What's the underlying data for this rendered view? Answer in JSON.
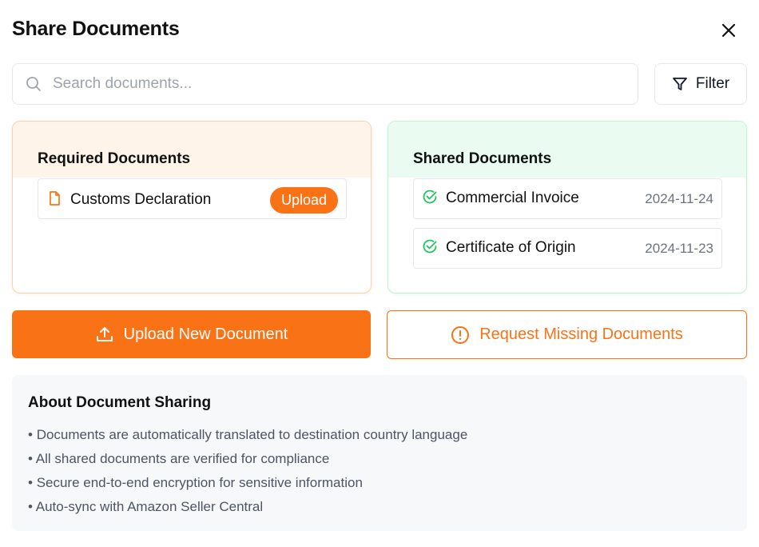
{
  "dialog": {
    "title": "Share Documents"
  },
  "search": {
    "placeholder": "Search documents...",
    "value": ""
  },
  "filter": {
    "label": "Filter"
  },
  "required": {
    "title": "Required Documents",
    "items": [
      {
        "name": "Customs Declaration",
        "action_label": "Upload"
      }
    ]
  },
  "shared": {
    "title": "Shared Documents",
    "items": [
      {
        "name": "Commercial Invoice",
        "date": "2024-11-24"
      },
      {
        "name": "Certificate of Origin",
        "date": "2024-11-23"
      }
    ]
  },
  "actions": {
    "upload_label": "Upload New Document",
    "request_label": "Request Missing Documents"
  },
  "about": {
    "title": "About Document Sharing",
    "points": [
      "Documents are automatically translated to destination country language",
      "All shared documents are verified for compliance",
      "Secure end-to-end encryption for sensitive information",
      "Auto-sync with Amazon Seller Central"
    ]
  },
  "colors": {
    "accent": "#f97316",
    "success": "#22c55e",
    "required_header_bg": "#fff4ea",
    "shared_header_bg": "#eafcf1"
  },
  "icons": {
    "close": "close-icon",
    "search": "search-icon",
    "filter": "filter-icon",
    "required_doc": "file-icon",
    "shared_doc": "check-circle-icon",
    "upload": "upload-icon",
    "request": "alert-circle-icon"
  }
}
